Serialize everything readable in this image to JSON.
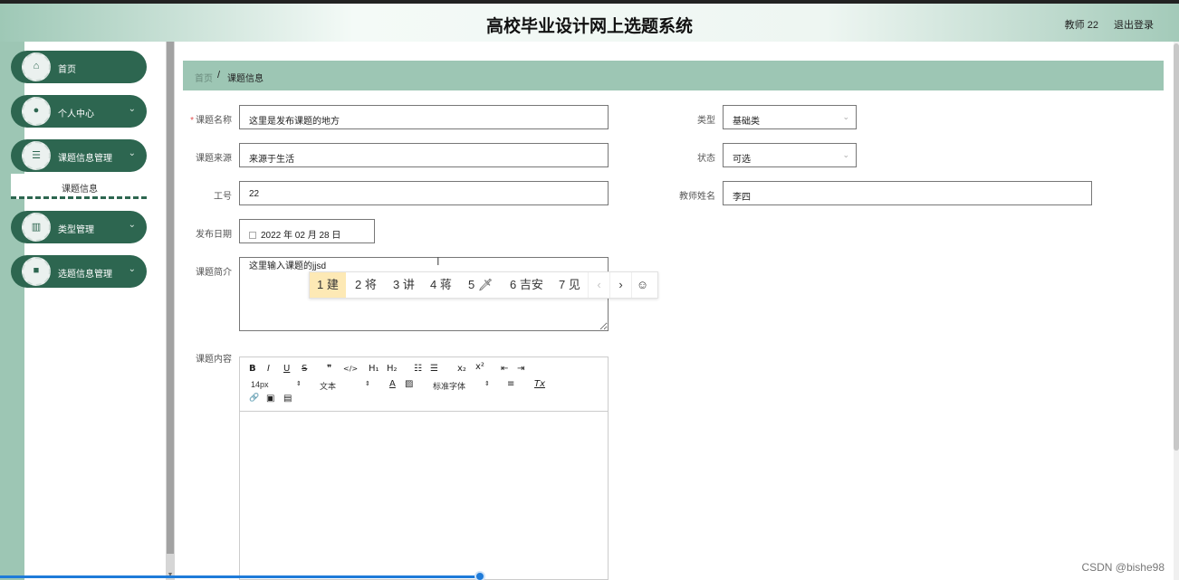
{
  "header": {
    "title": "高校毕业设计网上选题系统",
    "user": "教师 22",
    "logout": "退出登录"
  },
  "sidebar": {
    "items": [
      {
        "label": "首页",
        "icon": "home-icon",
        "glyph": "⌂",
        "has_children": false
      },
      {
        "label": "个人中心",
        "icon": "user-icon",
        "glyph": "●",
        "has_children": true
      },
      {
        "label": "课题信息管理",
        "icon": "settings-icon",
        "glyph": "☰",
        "has_children": true
      },
      {
        "label": "类型管理",
        "icon": "book-icon",
        "glyph": "▥",
        "has_children": true
      },
      {
        "label": "选题信息管理",
        "icon": "folder-icon",
        "glyph": "■",
        "has_children": true
      }
    ],
    "submenu_label": "课题信息",
    "chevron": "⌄"
  },
  "breadcrumb": {
    "home": "首页",
    "separator": "/",
    "current": "课题信息"
  },
  "form": {
    "name": {
      "label": "课题名称",
      "required_mark": "*",
      "value": "这里是发布课题的地方"
    },
    "type": {
      "label": "类型",
      "value": "基础类"
    },
    "source": {
      "label": "课题来源",
      "value": "来源于生活"
    },
    "status": {
      "label": "状态",
      "value": "可选"
    },
    "staff_no": {
      "label": "工号",
      "value": "22"
    },
    "teacher": {
      "label": "教师姓名",
      "value": "李四"
    },
    "date": {
      "label": "发布日期",
      "value": "2022 年 02 月 28 日"
    },
    "intro": {
      "label": "课题简介",
      "value": "这里输入课题的jjsd"
    },
    "content": {
      "label": "课题内容"
    }
  },
  "ime": {
    "candidates": [
      "1 建",
      "2 将",
      "3 讲",
      "4 蒋",
      "5 🗡",
      "6 吉安",
      "7 见"
    ],
    "prev": "‹",
    "next": "›",
    "emoji": "☺"
  },
  "editor": {
    "row1": [
      "B",
      "I",
      "U",
      "S",
      "❞",
      "</>",
      "H₁",
      "H₂",
      "☷",
      "☰",
      "x₂",
      "x²",
      "⇤",
      "⇥"
    ],
    "font_size": "14px",
    "text_style": "文本",
    "font_family": "标准字体",
    "row2_icons": [
      "A",
      "▨",
      "≡",
      "Tx"
    ],
    "row3_icons": [
      "🔗",
      "▣",
      "▤"
    ],
    "dropdown_arrow": "⇕"
  },
  "misc": {
    "cursor": "I",
    "watermark": "CSDN @bishe98"
  },
  "colors": {
    "sidebar_green": "#2d6650",
    "accent_green": "#9dc6b4",
    "ime_selected": "#fde9b5",
    "progress_blue": "#1e7bd9"
  }
}
